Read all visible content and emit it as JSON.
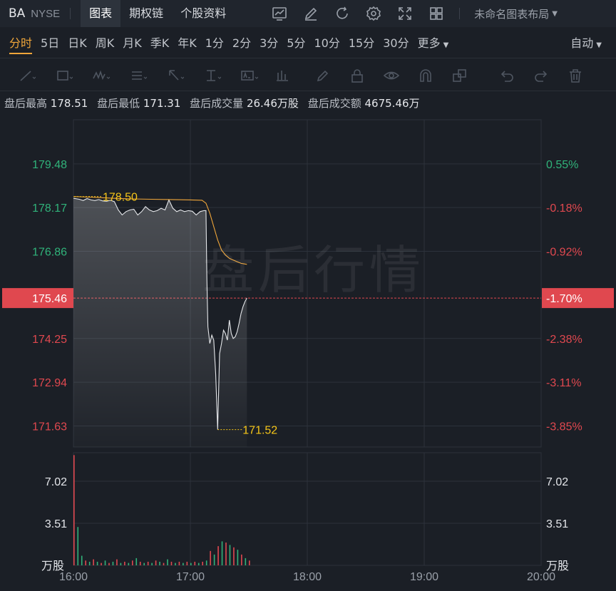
{
  "header": {
    "symbol": "BA",
    "exchange": "NYSE",
    "tabs": [
      {
        "label": "图表",
        "active": true
      },
      {
        "label": "期权链",
        "active": false
      },
      {
        "label": "个股资料",
        "active": false
      }
    ],
    "layout_label": "未命名图表布局"
  },
  "periods": [
    {
      "label": "分时",
      "active": true
    },
    {
      "label": "5日"
    },
    {
      "label": "日K"
    },
    {
      "label": "周K"
    },
    {
      "label": "月K"
    },
    {
      "label": "季K"
    },
    {
      "label": "年K"
    },
    {
      "label": "1分"
    },
    {
      "label": "2分"
    },
    {
      "label": "3分"
    },
    {
      "label": "5分"
    },
    {
      "label": "10分"
    },
    {
      "label": "15分"
    },
    {
      "label": "30分"
    },
    {
      "label": "更多",
      "dropdown": true
    }
  ],
  "scale_mode": "自动",
  "info": {
    "high_label": "盘后最高",
    "high_value": "178.51",
    "low_label": "盘后最低",
    "low_value": "171.31",
    "volume_label": "盘后成交量",
    "volume_value": "26.46万股",
    "amount_label": "盘后成交额",
    "amount_value": "4675.46万"
  },
  "watermark": "盘后行情",
  "colors": {
    "up": "#30b37a",
    "down": "#e0484f",
    "avg_line": "#f0a63a",
    "price_line": "#e6e8eb",
    "current_badge": "#e0484f",
    "marker_text": "#f5c518"
  },
  "chart_data": {
    "type": "line",
    "price_axis": {
      "left_ticks": [
        "179.48",
        "178.17",
        "176.86",
        "175.46",
        "174.25",
        "172.94",
        "171.63"
      ],
      "right_ticks": [
        "0.55%",
        "-0.18%",
        "-0.92%",
        "-1.70%",
        "-2.38%",
        "-3.11%",
        "-3.85%"
      ],
      "current_price": "175.46",
      "current_pct": "-1.70%",
      "ylim": [
        171.0,
        180.8
      ]
    },
    "markers": {
      "high": "178.50",
      "low": "171.52"
    },
    "x_ticks": [
      "16:00",
      "17:00",
      "18:00",
      "19:00",
      "20:00"
    ],
    "xlim": [
      0,
      240
    ],
    "price": [
      [
        0,
        178.45
      ],
      [
        3,
        178.42
      ],
      [
        5,
        178.38
      ],
      [
        7,
        178.44
      ],
      [
        9,
        178.4
      ],
      [
        11,
        178.38
      ],
      [
        13,
        178.41
      ],
      [
        15,
        178.37
      ],
      [
        17,
        178.36
      ],
      [
        19,
        178.39
      ],
      [
        21,
        178.35
      ],
      [
        23,
        178.1
      ],
      [
        25,
        177.95
      ],
      [
        27,
        178.05
      ],
      [
        29,
        178.1
      ],
      [
        31,
        178.12
      ],
      [
        33,
        177.95
      ],
      [
        35,
        178.05
      ],
      [
        37,
        178.2
      ],
      [
        39,
        178.1
      ],
      [
        41,
        178.05
      ],
      [
        43,
        178.08
      ],
      [
        45,
        178.15
      ],
      [
        47,
        178.1
      ],
      [
        49,
        178.4
      ],
      [
        51,
        178.15
      ],
      [
        53,
        178.05
      ],
      [
        55,
        178.1
      ],
      [
        57,
        178.05
      ],
      [
        59,
        178.08
      ],
      [
        61,
        178.06
      ],
      [
        63,
        177.95
      ],
      [
        65,
        178.05
      ],
      [
        67,
        178.08
      ],
      [
        68,
        178.08
      ],
      [
        68.5,
        176.0
      ],
      [
        69,
        174.6
      ],
      [
        70,
        174.1
      ],
      [
        71,
        174.35
      ],
      [
        72,
        174.2
      ],
      [
        73,
        173.2
      ],
      [
        74,
        171.52
      ],
      [
        75,
        173.8
      ],
      [
        76,
        174.1
      ],
      [
        77,
        174.5
      ],
      [
        78,
        174.4
      ],
      [
        79,
        174.2
      ],
      [
        80,
        174.8
      ],
      [
        81,
        174.4
      ],
      [
        82,
        174.25
      ],
      [
        83,
        174.3
      ],
      [
        84,
        174.45
      ],
      [
        85,
        174.7
      ],
      [
        86,
        175.0
      ],
      [
        87,
        175.2
      ],
      [
        88,
        175.35
      ],
      [
        89,
        175.46
      ]
    ],
    "average": [
      [
        0,
        178.5
      ],
      [
        10,
        178.48
      ],
      [
        20,
        178.45
      ],
      [
        30,
        178.43
      ],
      [
        40,
        178.42
      ],
      [
        50,
        178.41
      ],
      [
        60,
        178.4
      ],
      [
        66,
        178.39
      ],
      [
        68,
        178.3
      ],
      [
        70,
        178.0
      ],
      [
        72,
        177.6
      ],
      [
        74,
        177.2
      ],
      [
        76,
        176.9
      ],
      [
        78,
        176.75
      ],
      [
        80,
        176.65
      ],
      [
        82,
        176.6
      ],
      [
        84,
        176.55
      ],
      [
        86,
        176.5
      ],
      [
        88,
        176.48
      ],
      [
        89,
        176.47
      ]
    ],
    "volume": {
      "unit": "万股",
      "ticks": [
        "7.02",
        "3.51"
      ],
      "ylim": [
        0,
        9.4
      ],
      "bars": [
        [
          0,
          9.2,
          "down"
        ],
        [
          2,
          3.2,
          "up"
        ],
        [
          4,
          0.8,
          "up"
        ],
        [
          6,
          0.4,
          "down"
        ],
        [
          8,
          0.3,
          "up"
        ],
        [
          10,
          0.5,
          "down"
        ],
        [
          12,
          0.3,
          "up"
        ],
        [
          14,
          0.2,
          "down"
        ],
        [
          16,
          0.4,
          "up"
        ],
        [
          18,
          0.2,
          "down"
        ],
        [
          20,
          0.3,
          "up"
        ],
        [
          22,
          0.5,
          "down"
        ],
        [
          24,
          0.2,
          "up"
        ],
        [
          26,
          0.3,
          "down"
        ],
        [
          28,
          0.2,
          "up"
        ],
        [
          30,
          0.4,
          "down"
        ],
        [
          32,
          0.6,
          "up"
        ],
        [
          34,
          0.3,
          "down"
        ],
        [
          36,
          0.2,
          "up"
        ],
        [
          38,
          0.3,
          "down"
        ],
        [
          40,
          0.2,
          "up"
        ],
        [
          42,
          0.4,
          "down"
        ],
        [
          44,
          0.3,
          "up"
        ],
        [
          46,
          0.2,
          "down"
        ],
        [
          48,
          0.5,
          "up"
        ],
        [
          50,
          0.3,
          "down"
        ],
        [
          52,
          0.2,
          "up"
        ],
        [
          54,
          0.3,
          "down"
        ],
        [
          56,
          0.2,
          "up"
        ],
        [
          58,
          0.3,
          "down"
        ],
        [
          60,
          0.2,
          "up"
        ],
        [
          62,
          0.3,
          "down"
        ],
        [
          64,
          0.2,
          "up"
        ],
        [
          66,
          0.3,
          "down"
        ],
        [
          68,
          0.4,
          "up"
        ],
        [
          70,
          1.2,
          "down"
        ],
        [
          72,
          0.9,
          "up"
        ],
        [
          74,
          1.6,
          "down"
        ],
        [
          76,
          2.0,
          "up"
        ],
        [
          78,
          1.9,
          "down"
        ],
        [
          80,
          1.7,
          "up"
        ],
        [
          82,
          1.5,
          "down"
        ],
        [
          84,
          1.3,
          "up"
        ],
        [
          86,
          0.9,
          "down"
        ],
        [
          88,
          0.6,
          "up"
        ],
        [
          90,
          0.4,
          "down"
        ]
      ]
    }
  }
}
